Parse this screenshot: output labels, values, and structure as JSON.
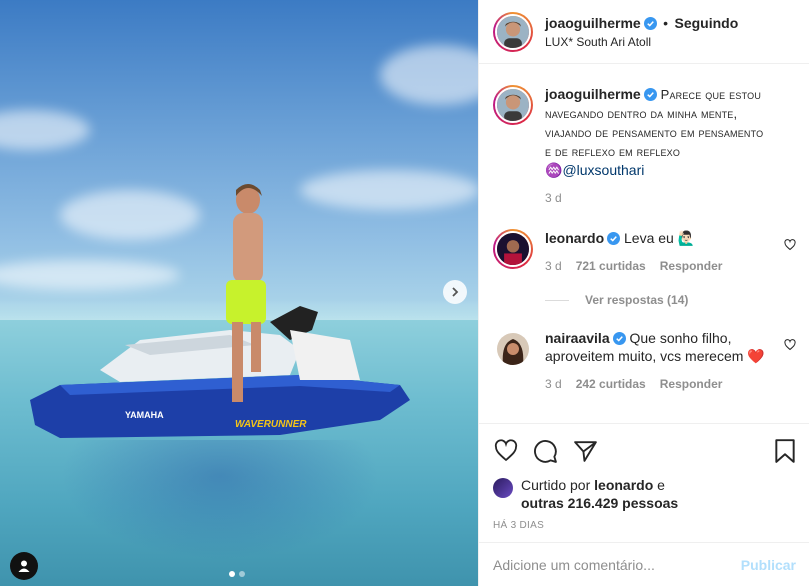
{
  "media": {
    "photo_description_icon": "jet-ski-photo",
    "carousel": {
      "current": 1,
      "total": 2
    }
  },
  "header": {
    "username": "joaoguilherme",
    "separator": "•",
    "follow_status": "Seguindo",
    "location": "LUX* South Ari Atoll"
  },
  "caption": {
    "username": "joaoguilherme",
    "text": "Parece que estou navegando dentro da minha mente, viajando de pensamento em pensamento e de reflexo em reflexo",
    "emoji": "♒",
    "mention": "@luxsouthari",
    "time": "3 d"
  },
  "comments": [
    {
      "username": "leonardo",
      "text": "Leva eu 🙋🏻‍♂️",
      "time": "3 d",
      "likes": "721 curtidas",
      "reply_label": "Responder",
      "view_replies": "Ver respostas (14)"
    },
    {
      "username": "nairaavila",
      "text": "Que sonho filho, aproveitem muito, vcs merecem ❤️",
      "time": "3 d",
      "likes": "242 curtidas",
      "reply_label": "Responder"
    }
  ],
  "likes": {
    "prefix": "Curtido por",
    "user": "leonardo",
    "connector": "e",
    "others": "outras 216.429 pessoas"
  },
  "time_ago": "HÁ 3 DIAS",
  "add_comment": {
    "placeholder": "Adicione um comentário...",
    "publish_label": "Publicar"
  },
  "colors": {
    "verified": "#3897f0",
    "link": "#00376b",
    "publish_disabled": "#b2dffc",
    "muted": "#8e8e8e"
  }
}
